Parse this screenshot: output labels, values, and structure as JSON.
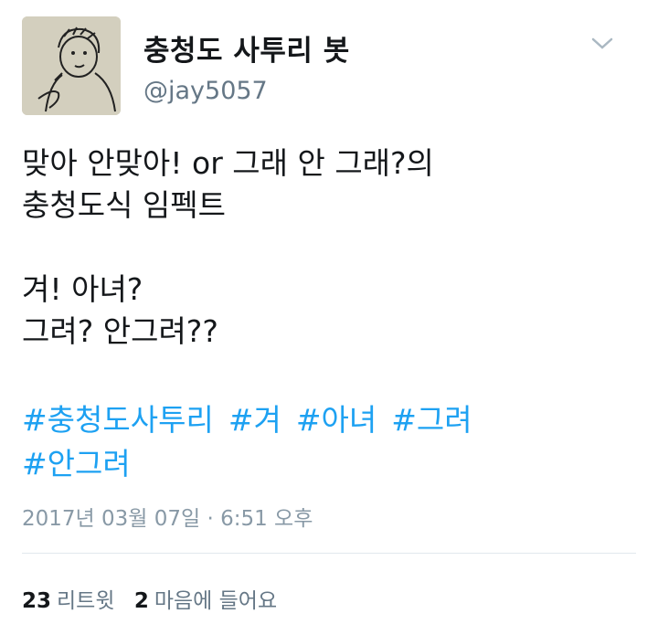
{
  "profile": {
    "display_name": "충청도 사투리 봇",
    "handle": "@jay5057",
    "avatar_icon": "sketch-avatar"
  },
  "menu_icon": "chevron-down-icon",
  "tweet": {
    "lines": [
      "맞아 안맞아! or 그래 안 그래?의",
      "충청도식 임펙트",
      "",
      "겨! 아녀?",
      "그려? 안그려??"
    ],
    "hashtags": [
      "#충청도사투리",
      "#겨",
      "#아녀",
      "#그려",
      "#안그려"
    ]
  },
  "timestamp": "2017년 03월 07일 · 6:51 오후",
  "stats": {
    "retweets_count": "23",
    "retweets_label": "리트윗",
    "likes_count": "2",
    "likes_label": "마음에 들어요"
  },
  "colors": {
    "link": "#1da1f2",
    "text": "#14171a",
    "muted": "#8899a6",
    "divider": "#e1e8ed"
  }
}
